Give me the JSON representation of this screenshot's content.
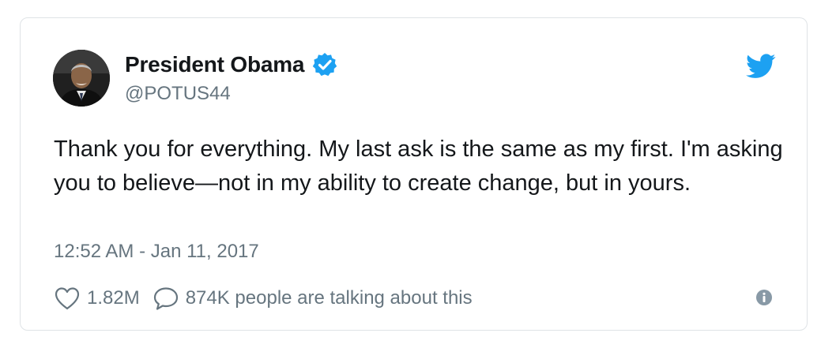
{
  "author": {
    "display_name": "President Obama",
    "handle": "@POTUS44",
    "verified": true
  },
  "tweet": {
    "text": "Thank you for everything. My last ask is the same as my first. I'm asking you to believe—not in my ability to create change, but in yours.",
    "timestamp": "12:52 AM - Jan 11, 2017"
  },
  "actions": {
    "likes": "1.82M",
    "talking": "874K people are talking about this"
  },
  "icons": {
    "verified": "verified-badge-icon",
    "brand": "twitter-bird-icon",
    "like": "heart-icon",
    "reply": "speech-bubble-icon",
    "info": "info-icon"
  },
  "colors": {
    "brand_blue": "#1da1f2",
    "text": "#14171a",
    "muted": "#66757f",
    "border": "#dfe3e6"
  }
}
